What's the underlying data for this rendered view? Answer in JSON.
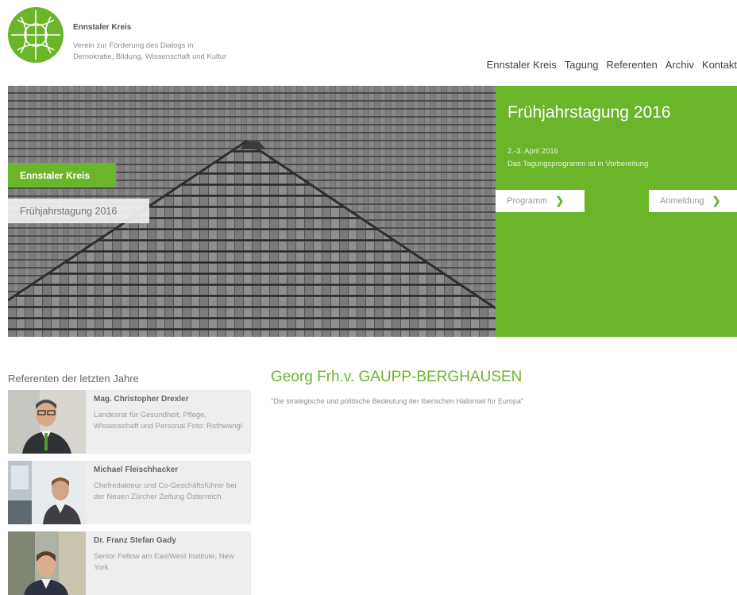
{
  "header": {
    "title": "Ennstaler Kreis",
    "subtitle_line1": "Verein zur Förderung des Dialogs in",
    "subtitle_line2": "Demokratie, Bildung, Wissenschaft und Kultur"
  },
  "nav": {
    "items": [
      {
        "label": "Ennstaler Kreis"
      },
      {
        "label": "Tagung"
      },
      {
        "label": "Referenten"
      },
      {
        "label": "Archiv"
      },
      {
        "label": "Kontakt"
      }
    ]
  },
  "hero": {
    "tag_primary": "Ennstaler Kreis",
    "tag_secondary": "Frühjahrstagung 2016",
    "panel_title": "Frühjahrstagung 2016",
    "date_line": "2.-3. April 2016",
    "status_line": "Das Tagungsprogramm ist in Vorbereitung",
    "btn_programm": "Programm",
    "btn_anmeldung": "Anmeldung",
    "accent_color": "#6ab52a"
  },
  "referees": {
    "heading": "Referenten der letzten Jahre",
    "items": [
      {
        "name": "Mag. Christopher Drexler",
        "desc": "Landesrat für Gesundheit, Pflege, Wissenschaft und Personal Foto: Rothwangl"
      },
      {
        "name": "Michael Fleischhacker",
        "desc": "Chefredakteur und Co-Geschäftsführer bei der Neuen Zürcher Zeitung Österreich"
      },
      {
        "name": "Dr. Franz Stefan Gady",
        "desc": "Senior Fellow am EastWest Institute, New York"
      }
    ]
  },
  "main": {
    "title": "Georg Frh.v. GAUPP-BERGHAUSEN",
    "quote": "\"Die strategische und politische Bedeutung der Iberischen Halbinsel für Europa\""
  }
}
